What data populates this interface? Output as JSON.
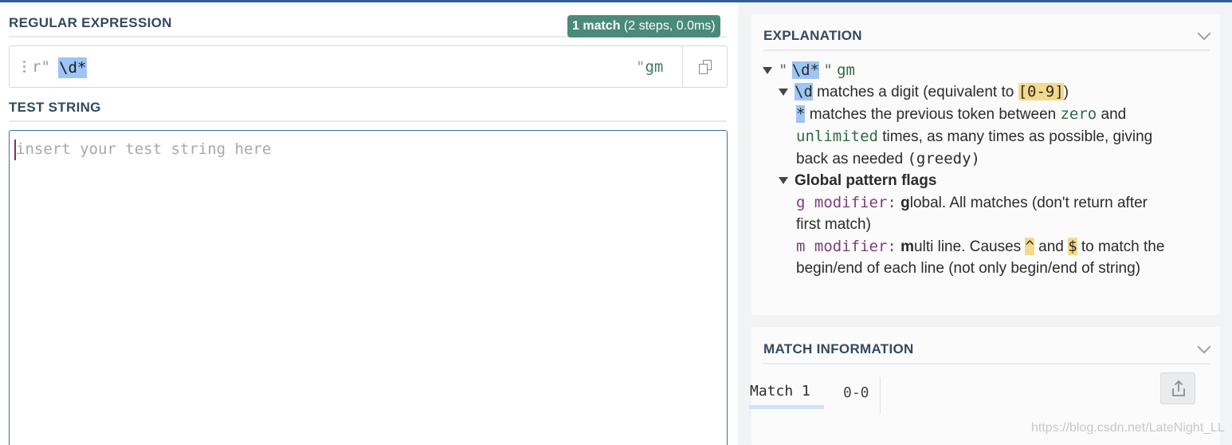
{
  "regex_section": {
    "title": "REGULAR EXPRESSION",
    "badge_count": "1 match",
    "badge_detail": " (2 steps, 0.0ms)",
    "prefix": "r\"",
    "pattern": "\\d*",
    "suffix_quote": "\"",
    "flags": "gm"
  },
  "test_section": {
    "title": "TEST STRING",
    "placeholder": "insert your test string here"
  },
  "explanation": {
    "title": "EXPLANATION",
    "root_quote_open": "\"",
    "root_pattern": "\\d*",
    "root_quote_close": "\"",
    "root_flags": "gm",
    "digit_token": "\\d",
    "digit_text": " matches a digit (equivalent to ",
    "digit_class": "[0-9]",
    "digit_close": ")",
    "star_token": "*",
    "star_text_1": " matches the previous token between ",
    "star_zero": "zero",
    "star_and": " and",
    "star_unlimited": "unlimited",
    "star_text_2": " times, as many times as possible, giving",
    "star_text_3": "back as needed ",
    "star_greedy": "(greedy)",
    "flags_heading": "Global pattern flags",
    "g_label": "g modifier:",
    "g_bold": "g",
    "g_text_1": "lobal. All matches (don't return after",
    "g_text_2": "first match)",
    "m_label": "m modifier:",
    "m_bold": "m",
    "m_text_1": "ulti line. Causes ",
    "m_caret": "^",
    "m_and": " and ",
    "m_dollar": "$",
    "m_text_2": " to match the",
    "m_text_3": "begin/end of each line (not only begin/end of string)"
  },
  "match_info": {
    "title": "MATCH INFORMATION",
    "tab_label": "Match 1",
    "range": "0-0"
  },
  "watermark": "https://blog.csdn.net/LateNight_LL",
  "colors": {
    "accent": "#2f5f97",
    "badge": "#4a8a78",
    "highlight_blue": "#9ec5f5",
    "highlight_yellow": "#f5d98b"
  },
  "icons": [
    "drag-handle-icon",
    "copy-icon",
    "chevron-down-icon",
    "collapse-triangle-icon",
    "share-icon"
  ]
}
